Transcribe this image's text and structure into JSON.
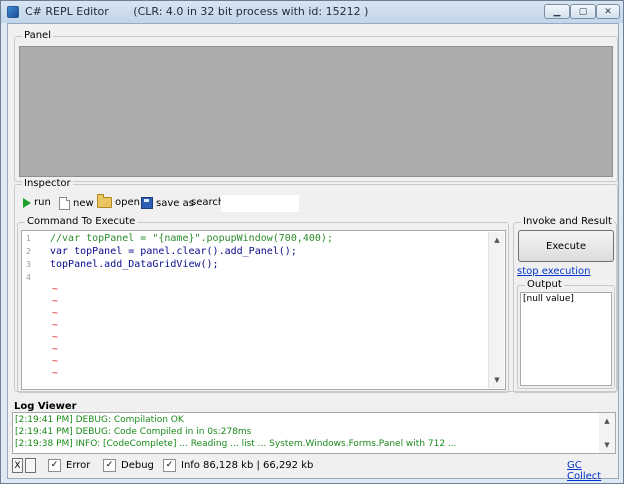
{
  "window": {
    "title": "C# REPL Editor",
    "subtitle": "(CLR: 4.0 in 32 bit process with id: 15212 )",
    "min_glyph": "▁",
    "max_glyph": "▢",
    "close_glyph": "✕"
  },
  "panel": {
    "title": "Panel"
  },
  "inspector": {
    "title": "Inspector",
    "toolbar": {
      "run": "run",
      "new": "new",
      "open": "open",
      "save_as": "save as",
      "search_label": "search:",
      "search_value": ""
    }
  },
  "command": {
    "title": "Command To Execute",
    "lines": [
      {
        "num": "1",
        "text": "//var topPanel = \"{name}\".popupWindow(700,400);"
      },
      {
        "num": "2",
        "text": "var topPanel = panel.clear().add_Panel();"
      },
      {
        "num": "3",
        "text": "topPanel.add_DataGridView();"
      },
      {
        "num": "4",
        "text": ""
      }
    ],
    "empty_marker": "~"
  },
  "invoke": {
    "title": "Invoke and Result",
    "execute_label": "Execute",
    "stop_label": "stop execution",
    "output_title": "Output",
    "output_value": "[null value]"
  },
  "log": {
    "title": "Log Viewer",
    "lines": [
      "[2:19:41 PM] DEBUG: Compilation OK",
      "[2:19:41 PM] DEBUG: Code Compiled in in 0s:278ms",
      "[2:19:38 PM] INFO: [CodeComplete] ... Reading ... list ... System.Windows.Forms.Panel with 712 ..."
    ]
  },
  "statusbar": {
    "clear_label": "X",
    "error_label": "Error",
    "debug_label": "Debug",
    "info_label": "Info",
    "check_glyph": "✓",
    "memory": "86,128 kb | 66,292 kb",
    "gc_label": "GC Collect"
  }
}
